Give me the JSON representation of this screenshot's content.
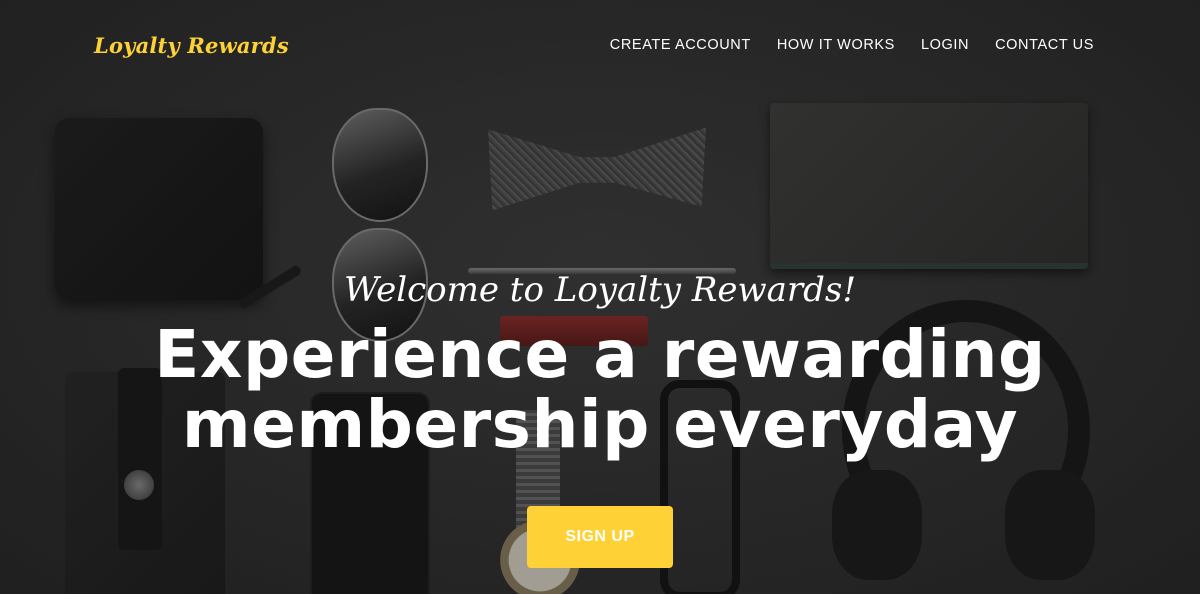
{
  "brand": {
    "name": "Loyalty Rewards",
    "color": "#fed136"
  },
  "nav": {
    "items": [
      {
        "label": "CREATE ACCOUNT"
      },
      {
        "label": "HOW IT WORKS"
      },
      {
        "label": "LOGIN"
      },
      {
        "label": "CONTACT US"
      }
    ]
  },
  "hero": {
    "subheading": "Welcome to Loyalty Rewards!",
    "heading": "Experience a rewarding membership everyday",
    "cta_label": "SIGN UP",
    "cta_color": "#fed136"
  }
}
